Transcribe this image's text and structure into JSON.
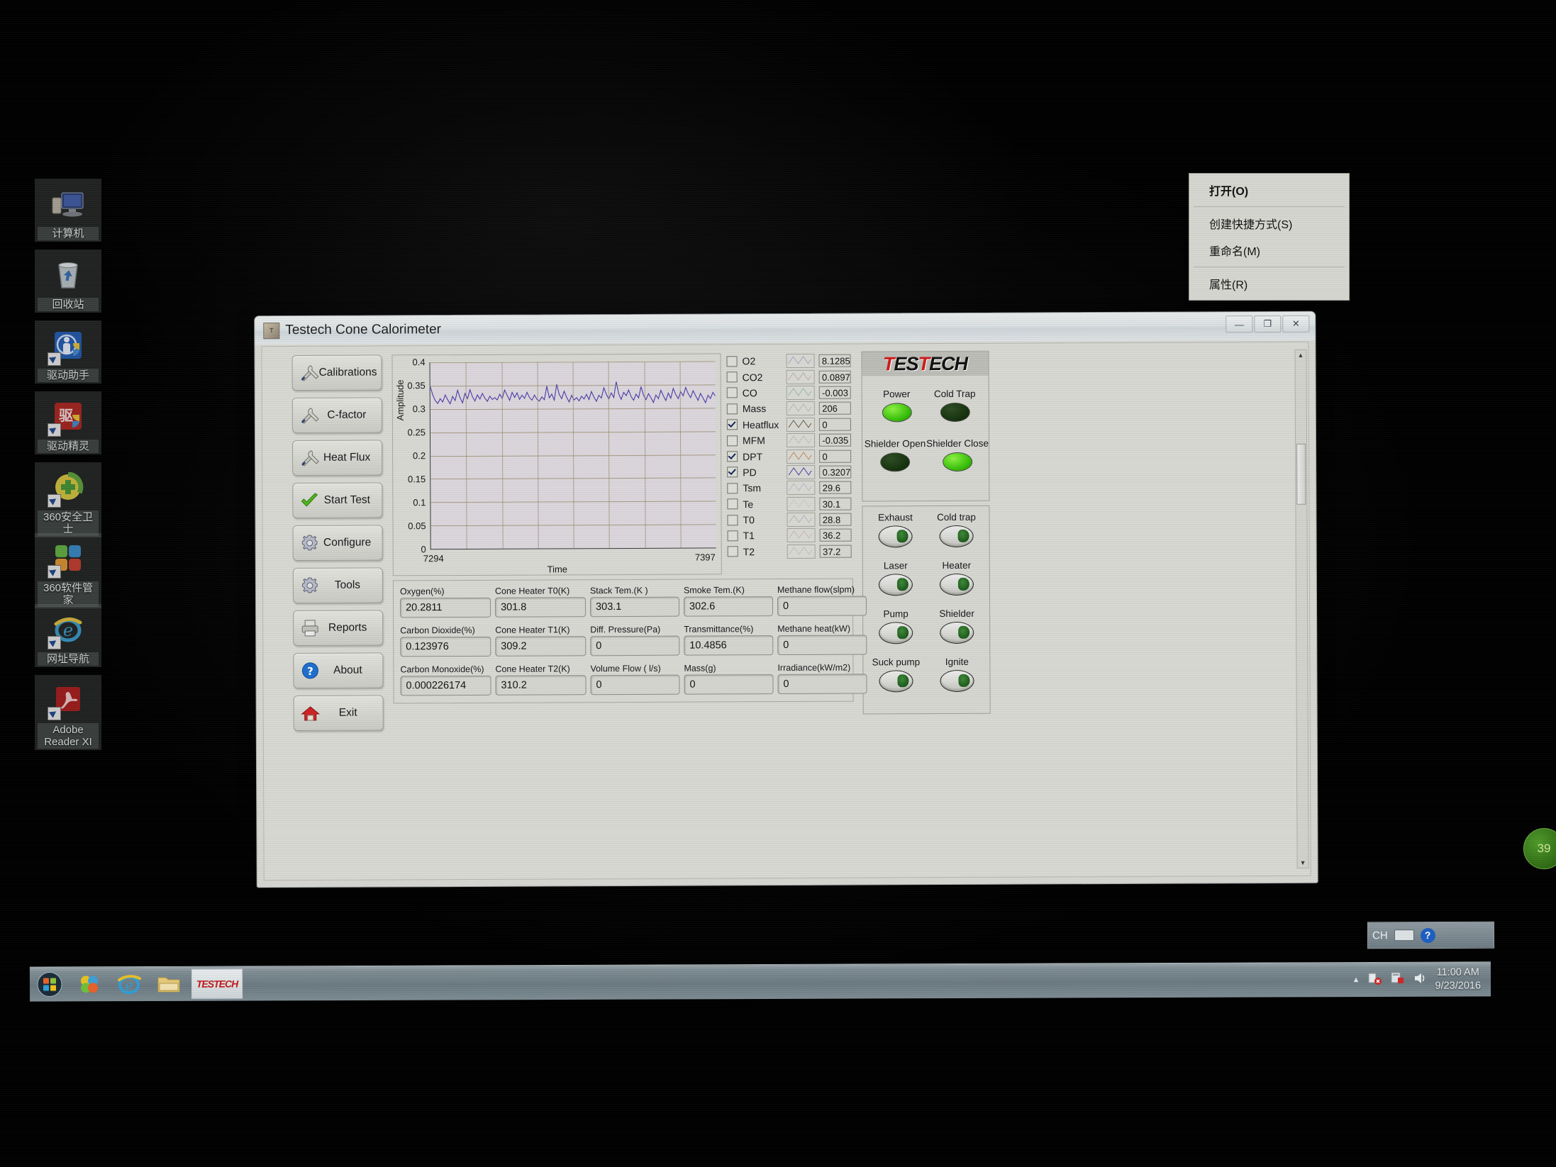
{
  "desktop": {
    "icons": [
      {
        "label": "计算机",
        "icon": "computer-icon"
      },
      {
        "label": "回收站",
        "icon": "recycle-bin-icon"
      },
      {
        "label": "驱动助手",
        "icon": "driver-assistant-icon"
      },
      {
        "label": "驱动精灵",
        "icon": "driver-genius-icon"
      },
      {
        "label": "360安全卫士",
        "icon": "360-safeguard-icon"
      },
      {
        "label": "360软件管家",
        "icon": "360-software-manager-icon"
      },
      {
        "label": "网址导航",
        "icon": "internet-explorer-icon"
      },
      {
        "label": "Adobe Reader XI",
        "icon": "adobe-reader-icon"
      }
    ],
    "badge_360": "39"
  },
  "context_menu": {
    "items": [
      {
        "label": "打开(O)",
        "bold": true
      },
      {
        "label": "创建快捷方式(S)",
        "bold": false
      },
      {
        "label": "重命名(M)",
        "bold": false
      },
      {
        "label": "属性(R)",
        "bold": false
      }
    ]
  },
  "window": {
    "title": "Testech Cone Calorimeter",
    "minimize": "—",
    "maximize": "❐",
    "close": "✕"
  },
  "buttons": [
    {
      "label": "Calibrations",
      "icon": "wrench-screwdriver-icon"
    },
    {
      "label": "C-factor",
      "icon": "wrench-screwdriver-icon"
    },
    {
      "label": "Heat Flux",
      "icon": "wrench-screwdriver-icon"
    },
    {
      "label": "Start Test",
      "icon": "green-check-icon"
    },
    {
      "label": "Configure",
      "icon": "gear-icon"
    },
    {
      "label": "Tools",
      "icon": "gear-icon"
    },
    {
      "label": "Reports",
      "icon": "printer-icon"
    },
    {
      "label": "About",
      "icon": "question-circle-icon"
    },
    {
      "label": "Exit",
      "icon": "red-house-icon"
    }
  ],
  "chart_data": {
    "type": "line",
    "title": "",
    "xlabel": "Time",
    "ylabel": "Amplitude",
    "xlim": [
      7294,
      7397
    ],
    "ylim": [
      0,
      0.4
    ],
    "xticklabels": [
      "7294",
      "7397"
    ],
    "yticklabels": [
      "0.4",
      "0.35",
      "0.3",
      "0.25",
      "0.2",
      "0.15",
      "0.1",
      "0.05",
      "0"
    ],
    "yticks": [
      0.4,
      0.35,
      0.3,
      0.25,
      0.2,
      0.15,
      0.1,
      0.05,
      0
    ],
    "grid": true,
    "legend": "none",
    "series": [
      {
        "name": "PD",
        "color": "#4a3aa8",
        "values": [
          0.348,
          0.33,
          0.318,
          0.312,
          0.322,
          0.315,
          0.33,
          0.32,
          0.311,
          0.327,
          0.318,
          0.34,
          0.324,
          0.313,
          0.333,
          0.322,
          0.341,
          0.326,
          0.317,
          0.33,
          0.321,
          0.333,
          0.323,
          0.316,
          0.327,
          0.32,
          0.324,
          0.319,
          0.331,
          0.322,
          0.34,
          0.329,
          0.318,
          0.335,
          0.324,
          0.334,
          0.32,
          0.329,
          0.322,
          0.335,
          0.324,
          0.318,
          0.329,
          0.32,
          0.316,
          0.325,
          0.319,
          0.348,
          0.323,
          0.331,
          0.318,
          0.352,
          0.33,
          0.321,
          0.337,
          0.324,
          0.314,
          0.328,
          0.318,
          0.323,
          0.316,
          0.326,
          0.32,
          0.33,
          0.319,
          0.336,
          0.324,
          0.315,
          0.328,
          0.322,
          0.344,
          0.33,
          0.32,
          0.333,
          0.323,
          0.357,
          0.331,
          0.319,
          0.334,
          0.327,
          0.339,
          0.325,
          0.317,
          0.33,
          0.322,
          0.346,
          0.328,
          0.318,
          0.331,
          0.322,
          0.312,
          0.328,
          0.32,
          0.338,
          0.326,
          0.316,
          0.332,
          0.321,
          0.342,
          0.329,
          0.32,
          0.335,
          0.326,
          0.344,
          0.331,
          0.322,
          0.337,
          0.326,
          0.316,
          0.331,
          0.321,
          0.311,
          0.327,
          0.32,
          0.333,
          0.325
        ]
      }
    ]
  },
  "channels": {
    "rows": [
      {
        "name": "O2",
        "checked": false,
        "value": "8.1285",
        "color": "#5b6f9e"
      },
      {
        "name": "CO2",
        "checked": false,
        "value": "0.0897",
        "color": "#9a6f8c"
      },
      {
        "name": "CO",
        "checked": false,
        "value": "-0.003",
        "color": "#57915a"
      },
      {
        "name": "Mass",
        "checked": false,
        "value": "206",
        "color": "#8c8c8c"
      },
      {
        "name": "Heatflux",
        "checked": true,
        "value": "0",
        "color": "#6a5a4a"
      },
      {
        "name": "MFM",
        "checked": false,
        "value": "-0.035",
        "color": "#b08fae"
      },
      {
        "name": "DPT",
        "checked": true,
        "value": "0",
        "color": "#c08a5a"
      },
      {
        "name": "PD",
        "checked": true,
        "value": "0.3207",
        "color": "#4a3aa8"
      },
      {
        "name": "Tsm",
        "checked": false,
        "value": "29.6",
        "color": "#a08ab8"
      },
      {
        "name": "Te",
        "checked": false,
        "value": "30.1",
        "color": "#b8b8b8"
      },
      {
        "name": "T0",
        "checked": false,
        "value": "28.8",
        "color": "#7a8fa8"
      },
      {
        "name": "T1",
        "checked": false,
        "value": "36.2",
        "color": "#b78f8f"
      },
      {
        "name": "T2",
        "checked": false,
        "value": "37.2",
        "color": "#9aa88f"
      }
    ]
  },
  "status_panel": {
    "logo": {
      "part1": "T",
      "part2": "ES",
      "part3": "T",
      "part4": "ECH"
    },
    "lamps": [
      {
        "label": "Power",
        "state": "on"
      },
      {
        "label": "Cold Trap",
        "state": "off"
      },
      {
        "label": "Shielder Open",
        "state": "off"
      },
      {
        "label": "Shielder Close",
        "state": "on"
      }
    ]
  },
  "switch_panel": {
    "switches": [
      {
        "label": "Exhaust"
      },
      {
        "label": "Cold trap"
      },
      {
        "label": "Laser"
      },
      {
        "label": "Heater"
      },
      {
        "label": "Pump"
      },
      {
        "label": "Shielder"
      },
      {
        "label": "Suck pump"
      },
      {
        "label": "Ignite"
      }
    ]
  },
  "readouts": {
    "col1": [
      {
        "label": "Oxygen(%)",
        "value": "20.2811"
      },
      {
        "label": "Carbon Dioxide(%)",
        "value": "0.123976"
      },
      {
        "label": "Carbon Monoxide(%)",
        "value": "0.000226174"
      }
    ],
    "col2": [
      {
        "label": "Cone Heater T0(K)",
        "value": "301.8"
      },
      {
        "label": "Cone Heater T1(K)",
        "value": "309.2"
      },
      {
        "label": "Cone Heater T2(K)",
        "value": "310.2"
      }
    ],
    "col3": [
      {
        "label": "Stack Tem.(K )",
        "value": "303.1"
      },
      {
        "label": "Diff. Pressure(Pa)",
        "value": "0"
      },
      {
        "label": "Volume Flow ( l/s)",
        "value": "0"
      }
    ],
    "col4": [
      {
        "label": "Smoke Tem.(K)",
        "value": "302.6"
      },
      {
        "label": "Transmittance(%)",
        "value": "10.4856"
      },
      {
        "label": "Mass(g)",
        "value": "0"
      }
    ],
    "col5": [
      {
        "label": "Methane flow(slpm)",
        "value": "0"
      },
      {
        "label": "Methane heat(kW)",
        "value": "0"
      },
      {
        "label": "Irradiance(kW/m2)",
        "value": "0"
      }
    ]
  },
  "taskbar": {
    "start": "start-orb-icon",
    "pinned": [
      "media-player-icon",
      "internet-explorer-icon",
      "folder-icon"
    ],
    "active_app": "TESTECH",
    "tray_icons": [
      "show-hidden-icon",
      "network-error-icon",
      "action-center-icon",
      "volume-icon"
    ],
    "clock_time": "11:00 AM",
    "clock_date": "9/23/2016"
  },
  "ime_bar": {
    "lang": "CH",
    "keyboard": "keyboard-icon",
    "help": "?"
  }
}
